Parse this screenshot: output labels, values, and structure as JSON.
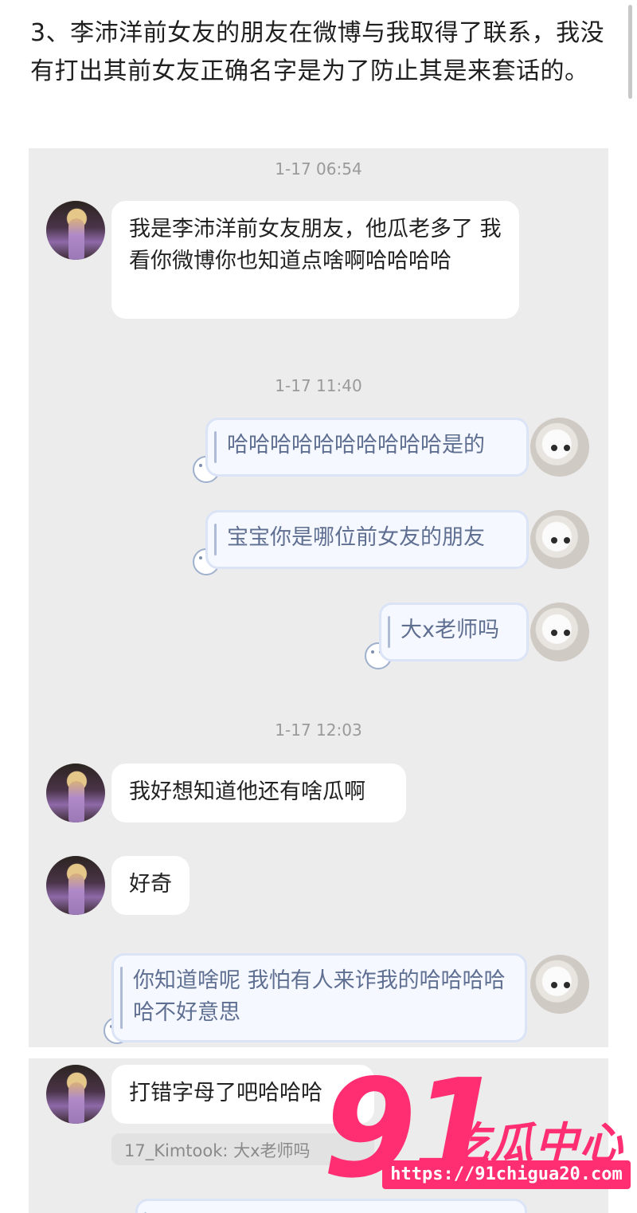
{
  "caption": "3、李沛洋前女友的朋友在微博与我取得了联系，我没有打出其前女友正确名字是为了防止其是来套话的。",
  "timestamps": [
    "1-17 06:54",
    "1-17 11:40",
    "1-17 12:03"
  ],
  "messages": {
    "m1": "我是李沛洋前女友朋友，他瓜老多了 我看你微博你也知道点啥啊哈哈哈哈",
    "m2": "哈哈哈哈哈哈哈哈哈哈是的",
    "m3": "宝宝你是哪位前女友的朋友",
    "m4": "大x老师吗",
    "m5": "我好想知道他还有啥瓜啊",
    "m6": "好奇",
    "m7": "你知道啥呢 我怕有人来诈我的哈哈哈哈哈不好意思",
    "m8": "打错字母了吧哈哈哈"
  },
  "quote": "17_Kimtook: 大x老师吗",
  "watermark": {
    "number": "91",
    "text": "吃瓜中心",
    "url": "https://91chigua20.com"
  }
}
